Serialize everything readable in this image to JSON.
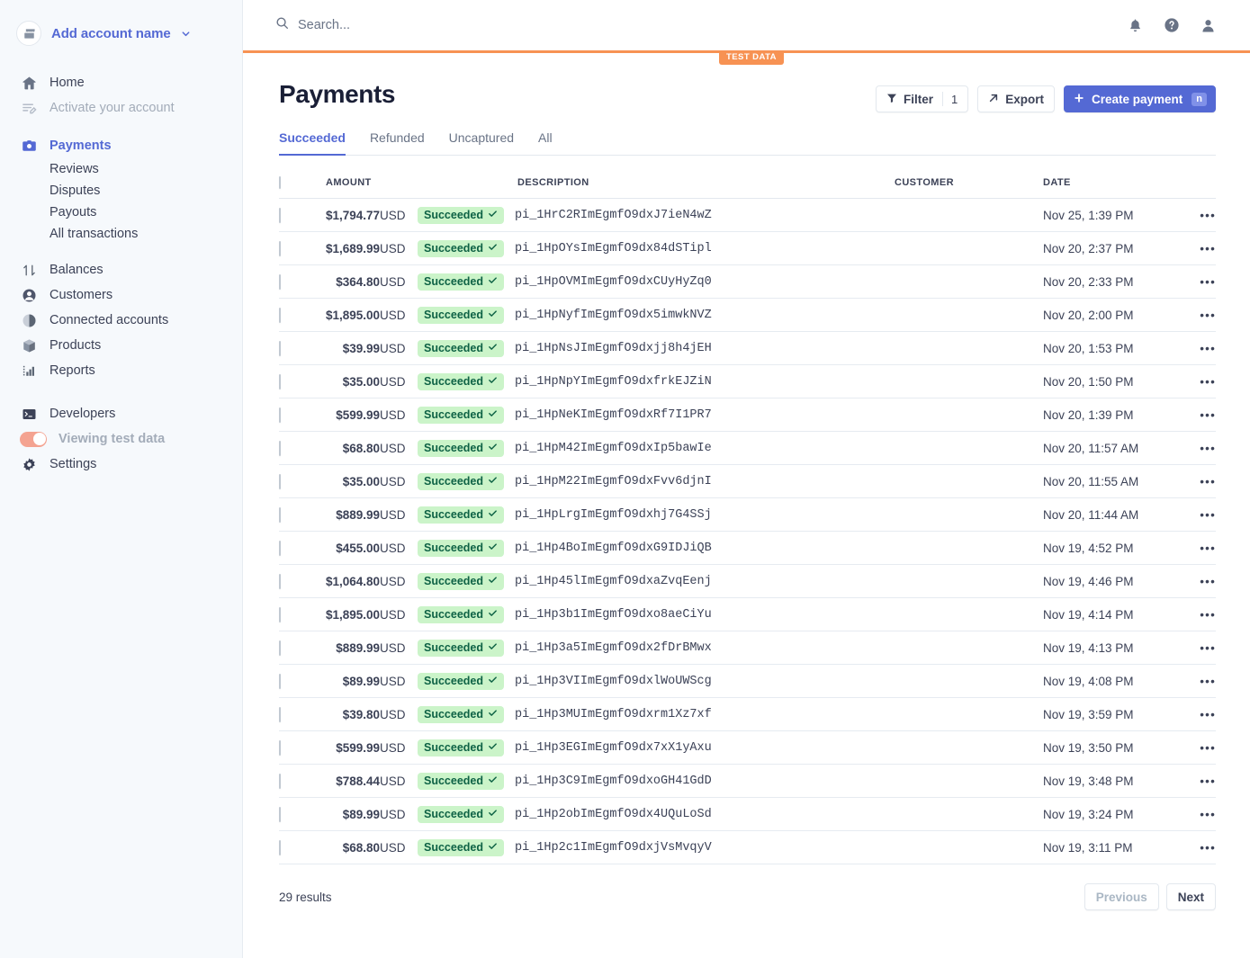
{
  "sidebar": {
    "account": {
      "name": "Add account name",
      "icon": "store-icon",
      "chevron": "chevron-down-icon"
    },
    "items": [
      {
        "label": "Home",
        "icon": "home-icon",
        "state": "normal"
      },
      {
        "label": "Activate your account",
        "icon": "activate-icon",
        "state": "muted"
      },
      {
        "label": "Payments",
        "icon": "payments-icon",
        "state": "active"
      },
      {
        "label": "Balances",
        "icon": "balances-icon",
        "state": "normal"
      },
      {
        "label": "Customers",
        "icon": "customers-icon",
        "state": "normal"
      },
      {
        "label": "Connected accounts",
        "icon": "connected-accounts-icon",
        "state": "normal"
      },
      {
        "label": "Products",
        "icon": "products-icon",
        "state": "normal"
      },
      {
        "label": "Reports",
        "icon": "reports-icon",
        "state": "normal"
      },
      {
        "label": "Developers",
        "icon": "developers-icon",
        "state": "normal"
      },
      {
        "label": "Settings",
        "icon": "gear-icon",
        "state": "normal"
      }
    ],
    "sub_items": [
      "Reviews",
      "Disputes",
      "Payouts",
      "All transactions"
    ],
    "test_toggle": {
      "label": "Viewing test data",
      "on": true,
      "color": "#f4a391"
    }
  },
  "topbar": {
    "search_placeholder": "Search...",
    "icons": [
      "bell-icon",
      "help-icon",
      "account-icon"
    ]
  },
  "test_banner": {
    "label": "TEST DATA",
    "color": "#f79253"
  },
  "header": {
    "title": "Payments",
    "filter_label": "Filter",
    "filter_count": "1",
    "export_label": "Export",
    "create_label": "Create payment",
    "create_shortcut": "n",
    "accent": "#5469d4"
  },
  "tabs": [
    {
      "label": "Succeeded",
      "selected": true
    },
    {
      "label": "Refunded",
      "selected": false
    },
    {
      "label": "Uncaptured",
      "selected": false
    },
    {
      "label": "All",
      "selected": false
    }
  ],
  "table": {
    "columns": [
      "AMOUNT",
      "DESCRIPTION",
      "CUSTOMER",
      "DATE"
    ],
    "status_label": "Succeeded",
    "rows": [
      {
        "amount": "$1,794.77",
        "currency": "USD",
        "status": "Succeeded",
        "description": "pi_1HrC2RImEgmfO9dxJ7ieN4wZ",
        "customer": "",
        "date": "Nov 25, 1:39 PM"
      },
      {
        "amount": "$1,689.99",
        "currency": "USD",
        "status": "Succeeded",
        "description": "pi_1HpOYsImEgmfO9dx84dSTipl",
        "customer": "",
        "date": "Nov 20, 2:37 PM"
      },
      {
        "amount": "$364.80",
        "currency": "USD",
        "status": "Succeeded",
        "description": "pi_1HpOVMImEgmfO9dxCUyHyZq0",
        "customer": "",
        "date": "Nov 20, 2:33 PM"
      },
      {
        "amount": "$1,895.00",
        "currency": "USD",
        "status": "Succeeded",
        "description": "pi_1HpNyfImEgmfO9dx5imwkNVZ",
        "customer": "",
        "date": "Nov 20, 2:00 PM"
      },
      {
        "amount": "$39.99",
        "currency": "USD",
        "status": "Succeeded",
        "description": "pi_1HpNsJImEgmfO9dxjj8h4jEH",
        "customer": "",
        "date": "Nov 20, 1:53 PM"
      },
      {
        "amount": "$35.00",
        "currency": "USD",
        "status": "Succeeded",
        "description": "pi_1HpNpYImEgmfO9dxfrkEJZiN",
        "customer": "",
        "date": "Nov 20, 1:50 PM"
      },
      {
        "amount": "$599.99",
        "currency": "USD",
        "status": "Succeeded",
        "description": "pi_1HpNeKImEgmfO9dxRf7I1PR7",
        "customer": "",
        "date": "Nov 20, 1:39 PM"
      },
      {
        "amount": "$68.80",
        "currency": "USD",
        "status": "Succeeded",
        "description": "pi_1HpM42ImEgmfO9dxIp5bawIe",
        "customer": "",
        "date": "Nov 20, 11:57 AM"
      },
      {
        "amount": "$35.00",
        "currency": "USD",
        "status": "Succeeded",
        "description": "pi_1HpM22ImEgmfO9dxFvv6djnI",
        "customer": "",
        "date": "Nov 20, 11:55 AM"
      },
      {
        "amount": "$889.99",
        "currency": "USD",
        "status": "Succeeded",
        "description": "pi_1HpLrgImEgmfO9dxhj7G4SSj",
        "customer": "",
        "date": "Nov 20, 11:44 AM"
      },
      {
        "amount": "$455.00",
        "currency": "USD",
        "status": "Succeeded",
        "description": "pi_1Hp4BoImEgmfO9dxG9IDJiQB",
        "customer": "",
        "date": "Nov 19, 4:52 PM"
      },
      {
        "amount": "$1,064.80",
        "currency": "USD",
        "status": "Succeeded",
        "description": "pi_1Hp45lImEgmfO9dxaZvqEenj",
        "customer": "",
        "date": "Nov 19, 4:46 PM"
      },
      {
        "amount": "$1,895.00",
        "currency": "USD",
        "status": "Succeeded",
        "description": "pi_1Hp3b1ImEgmfO9dxo8aeCiYu",
        "customer": "",
        "date": "Nov 19, 4:14 PM"
      },
      {
        "amount": "$889.99",
        "currency": "USD",
        "status": "Succeeded",
        "description": "pi_1Hp3a5ImEgmfO9dx2fDrBMwx",
        "customer": "",
        "date": "Nov 19, 4:13 PM"
      },
      {
        "amount": "$89.99",
        "currency": "USD",
        "status": "Succeeded",
        "description": "pi_1Hp3VIImEgmfO9dxlWoUWScg",
        "customer": "",
        "date": "Nov 19, 4:08 PM"
      },
      {
        "amount": "$39.80",
        "currency": "USD",
        "status": "Succeeded",
        "description": "pi_1Hp3MUImEgmfO9dxrm1Xz7xf",
        "customer": "",
        "date": "Nov 19, 3:59 PM"
      },
      {
        "amount": "$599.99",
        "currency": "USD",
        "status": "Succeeded",
        "description": "pi_1Hp3EGImEgmfO9dx7xX1yAxu",
        "customer": "",
        "date": "Nov 19, 3:50 PM"
      },
      {
        "amount": "$788.44",
        "currency": "USD",
        "status": "Succeeded",
        "description": "pi_1Hp3C9ImEgmfO9dxoGH41GdD",
        "customer": "",
        "date": "Nov 19, 3:48 PM"
      },
      {
        "amount": "$89.99",
        "currency": "USD",
        "status": "Succeeded",
        "description": "pi_1Hp2obImEgmfO9dx4UQuLoSd",
        "customer": "",
        "date": "Nov 19, 3:24 PM"
      },
      {
        "amount": "$68.80",
        "currency": "USD",
        "status": "Succeeded",
        "description": "pi_1Hp2c1ImEgmfO9dxjVsMvqyV",
        "customer": "",
        "date": "Nov 19, 3:11 PM"
      }
    ]
  },
  "footer": {
    "results": "29 results",
    "previous_label": "Previous",
    "next_label": "Next"
  }
}
